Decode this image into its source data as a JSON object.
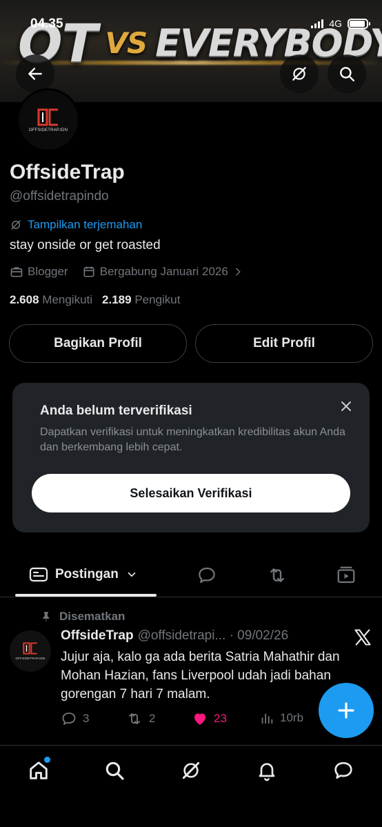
{
  "status_bar": {
    "time": "04.35",
    "network": "4G"
  },
  "banner": {
    "text_ot": "OT",
    "text_vs": "VS",
    "text_every": "EVERYBODY"
  },
  "avatar": {
    "logo_text": "OFFSIDETRAP.IDN"
  },
  "profile": {
    "name": "OffsideTrap",
    "handle": "@offsidetrapindo",
    "translate_label": "Tampilkan terjemahan",
    "bio": "stay onside or get roasted",
    "category": "Blogger",
    "joined": "Bergabung Januari 2026",
    "following_count": "2.608",
    "following_label": "Mengikuti",
    "followers_count": "2.189",
    "followers_label": "Pengikut"
  },
  "buttons": {
    "share_profile": "Bagikan Profil",
    "edit_profile": "Edit Profil"
  },
  "verify_card": {
    "title": "Anda belum terverifikasi",
    "description": "Dapatkan verifikasi untuk meningkatkan kredibilitas akun Anda dan berkembang lebih cepat.",
    "button": "Selesaikan Verifikasi"
  },
  "tabs": {
    "active_label": "Postingan"
  },
  "post": {
    "pinned_label": "Disematkan",
    "author": "OffsideTrap",
    "handle_date": "@offsidetrapi... · 09/02/26",
    "text": "Jujur aja, kalo ga ada berita Satria Mahathir dan Mohan Hazian, fans Liverpool udah jadi bahan gorengan 7 hari 7 malam.",
    "replies": "3",
    "reposts": "2",
    "likes": "23",
    "views": "10rb"
  },
  "colors": {
    "accent": "#1d9bf0",
    "like": "#f91880",
    "muted": "#71767b",
    "text": "#e7e9ea",
    "card_bg": "#202327"
  }
}
